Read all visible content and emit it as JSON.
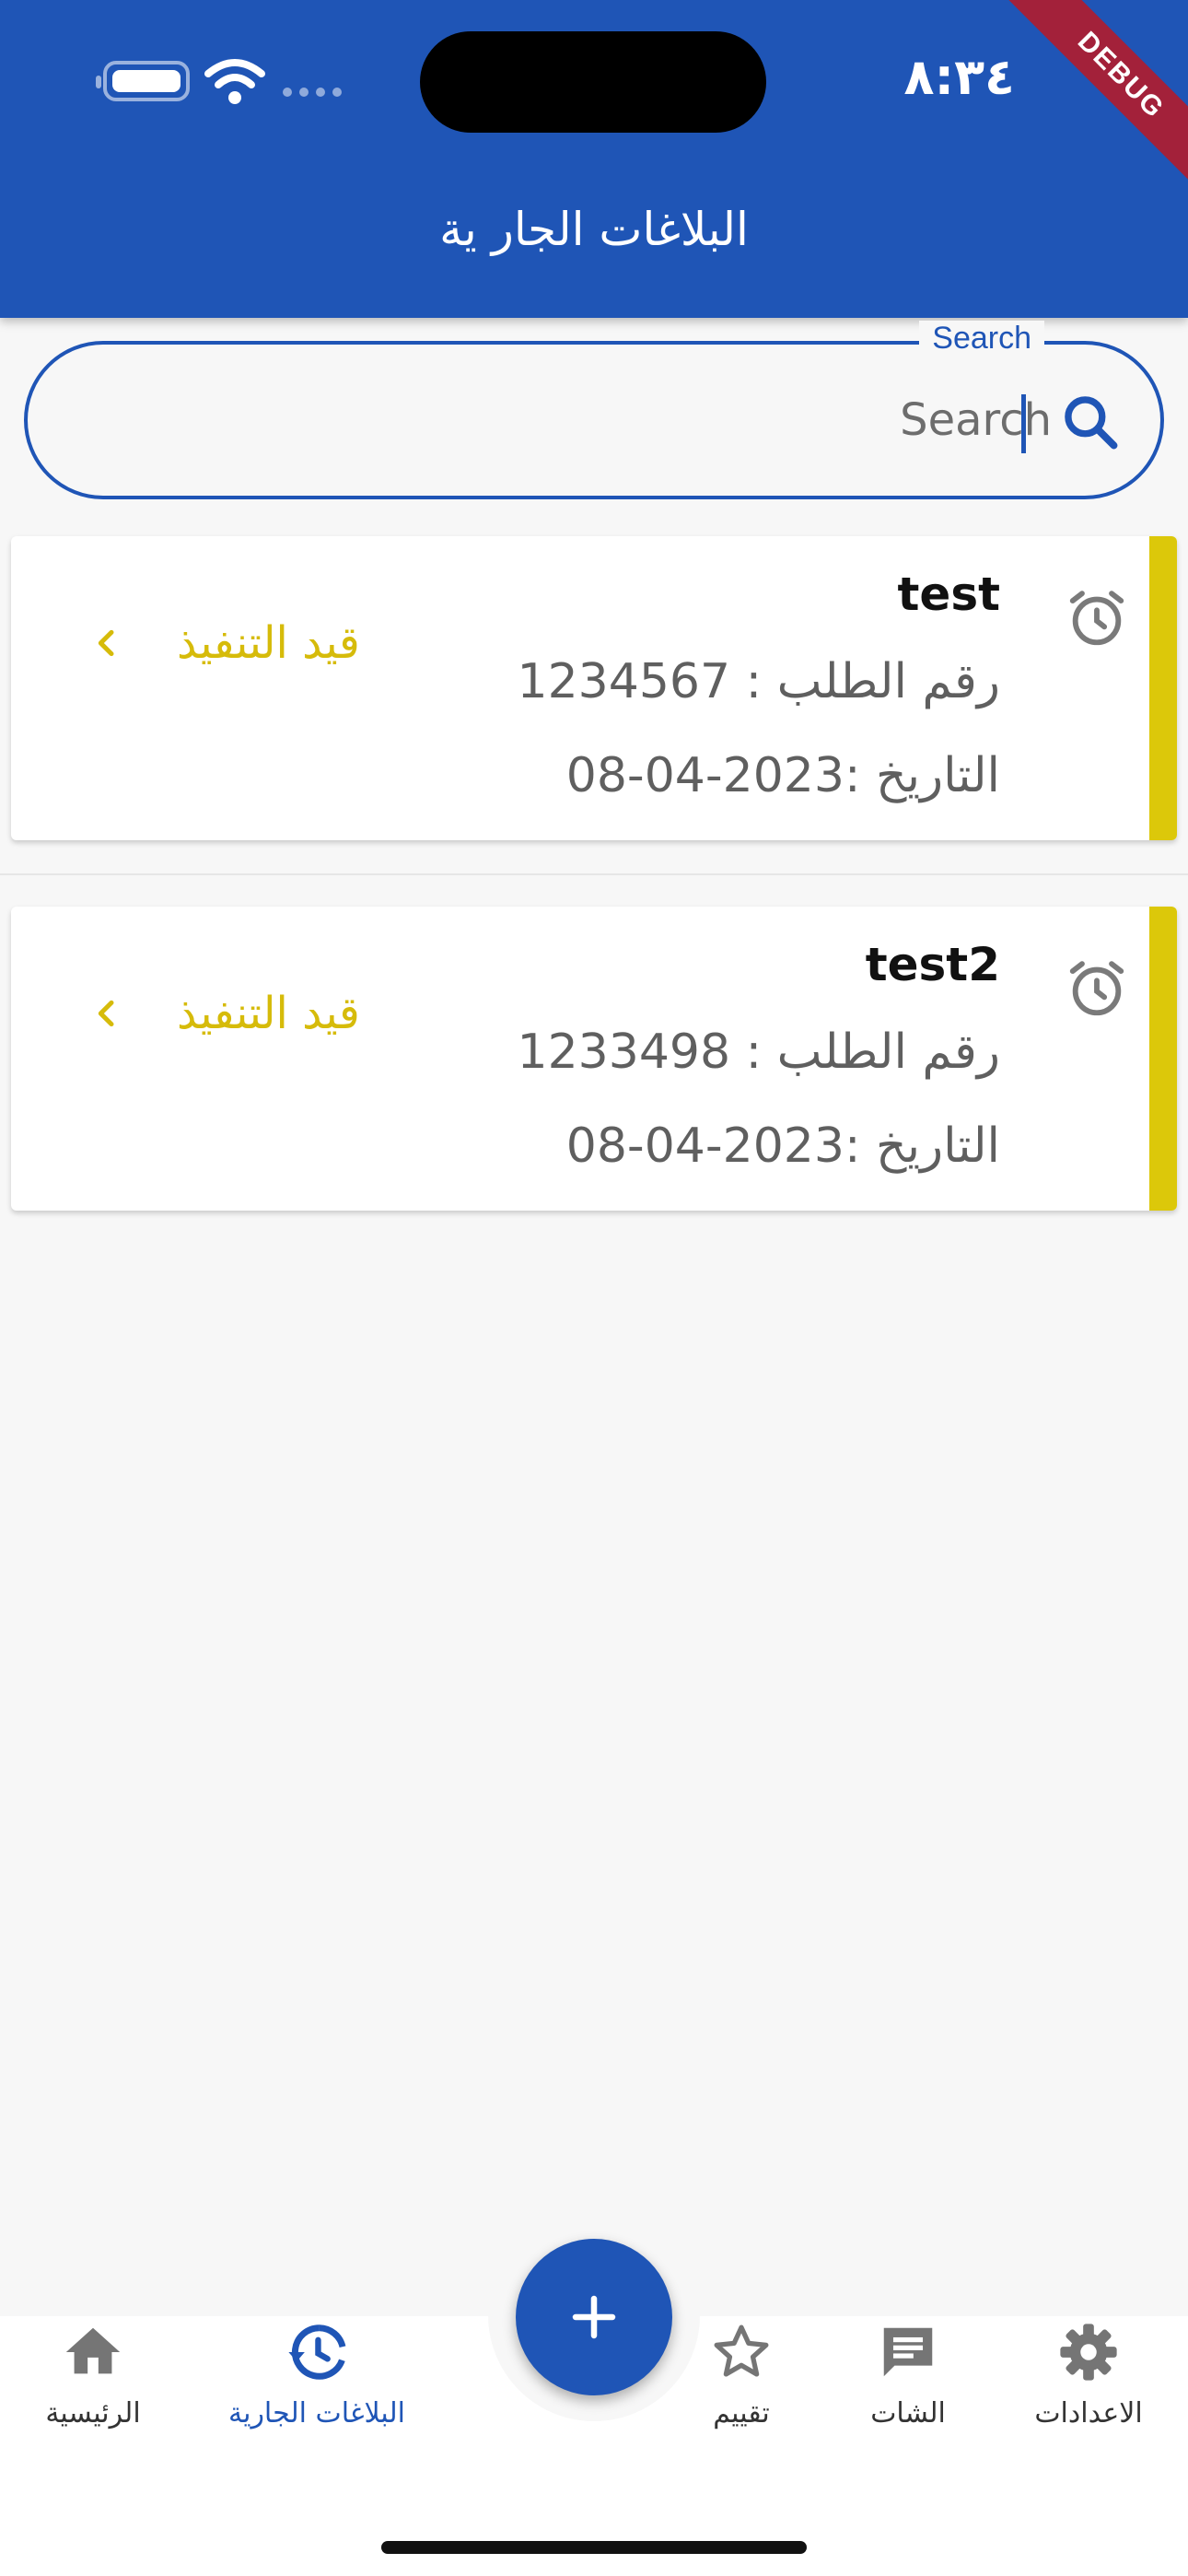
{
  "status_bar": {
    "time": "٨:٣٤",
    "debug_banner": "DEBUG"
  },
  "header": {
    "title": "البلاغات الجار ية"
  },
  "search": {
    "label": "Search",
    "placeholder": "Search",
    "value": ""
  },
  "reports": [
    {
      "title": "test",
      "order_number_line": "رقم الطلب : 1234567",
      "date_line": "التاريخ :2023-04-08",
      "status": "قيد التنفيذ"
    },
    {
      "title": "test2",
      "order_number_line": "رقم الطلب : 1233498",
      "date_line": "التاريخ :2023-04-08",
      "status": "قيد التنفيذ"
    }
  ],
  "bottom_nav": {
    "items": [
      {
        "label": "الرئيسية",
        "icon": "home-icon"
      },
      {
        "label": "البلاغات الجارية",
        "icon": "history-icon"
      },
      {
        "label": "تقييم",
        "icon": "star-icon"
      },
      {
        "label": "الشات",
        "icon": "chat-icon"
      },
      {
        "label": "الاعدادات",
        "icon": "settings-icon"
      }
    ],
    "active_index": 1,
    "fab_icon": "plus-icon"
  },
  "colors": {
    "primary": "#1f55b6",
    "accent_yellow": "#dcc80a",
    "status_text": "#d6bb0a",
    "debug_banner": "#a3213a"
  }
}
